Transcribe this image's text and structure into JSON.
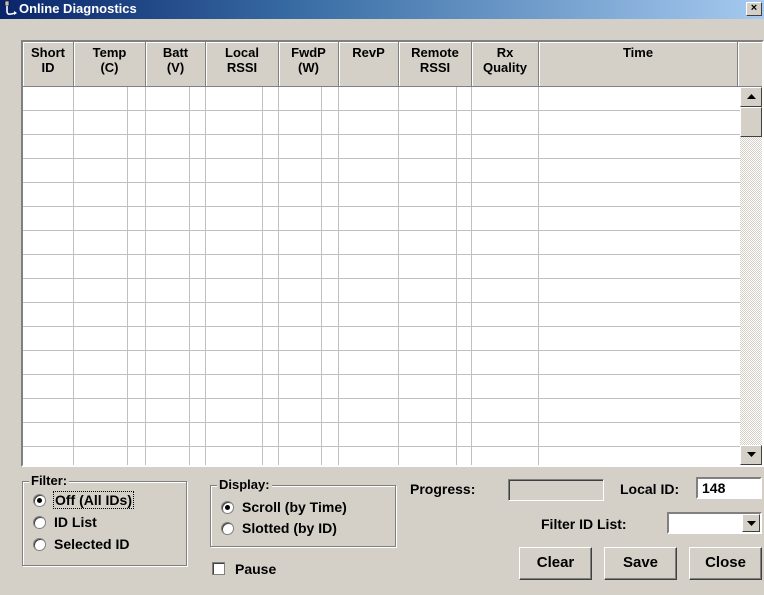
{
  "window": {
    "title": "Online Diagnostics",
    "close_glyph": "×"
  },
  "grid": {
    "headers": [
      "Short\nID",
      "Temp\n(C)",
      "Batt\n(V)",
      "Local\nRSSI",
      "FwdP\n(W)",
      "RevP",
      "Remote\nRSSI",
      "Rx\nQuality",
      "Time"
    ],
    "rows": []
  },
  "filter": {
    "title": "Filter:",
    "options": [
      "Off (All IDs)",
      "ID List",
      "Selected ID"
    ],
    "selected_index": 0
  },
  "display": {
    "title": "Display:",
    "options": [
      "Scroll (by Time)",
      "Slotted (by ID)"
    ],
    "selected_index": 0
  },
  "pause": {
    "label": "Pause",
    "checked": false
  },
  "progress": {
    "label": "Progress:",
    "value": 0
  },
  "local_id": {
    "label": "Local ID:",
    "value": "148"
  },
  "filter_id_list": {
    "label": "Filter ID List:",
    "value": ""
  },
  "buttons": {
    "clear": "Clear",
    "save": "Save",
    "close": "Close"
  },
  "icons": {
    "window": "network-diagnostics-icon",
    "scroll_up": "arrow-up-icon",
    "scroll_down": "arrow-down-icon",
    "combo": "chevron-down-icon"
  }
}
